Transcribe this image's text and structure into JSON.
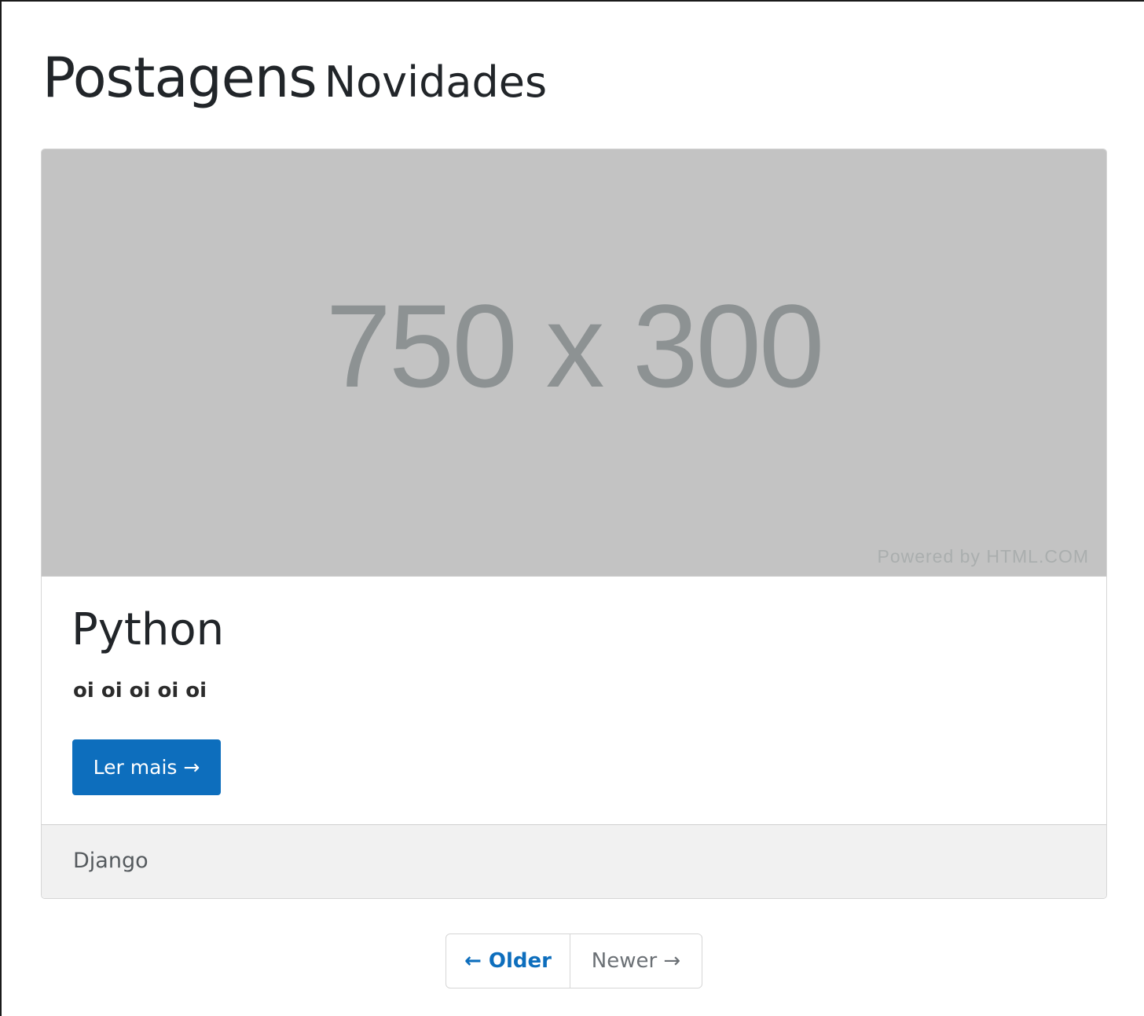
{
  "heading": {
    "main": "Postagens",
    "sub": "Novidades"
  },
  "post": {
    "image": {
      "dimensions_text": "750 x 300",
      "powered_text": "Powered by HTML.COM"
    },
    "title": "Python",
    "excerpt": "oi oi oi oi oi",
    "read_more_label": "Ler mais →",
    "category": "Django"
  },
  "pagination": {
    "older_label": "← Older",
    "newer_label": "Newer →"
  },
  "colors": {
    "primary": "#0d6ebd",
    "placeholder_bg": "#c3c3c3",
    "footer_bg": "#f1f1f1"
  }
}
